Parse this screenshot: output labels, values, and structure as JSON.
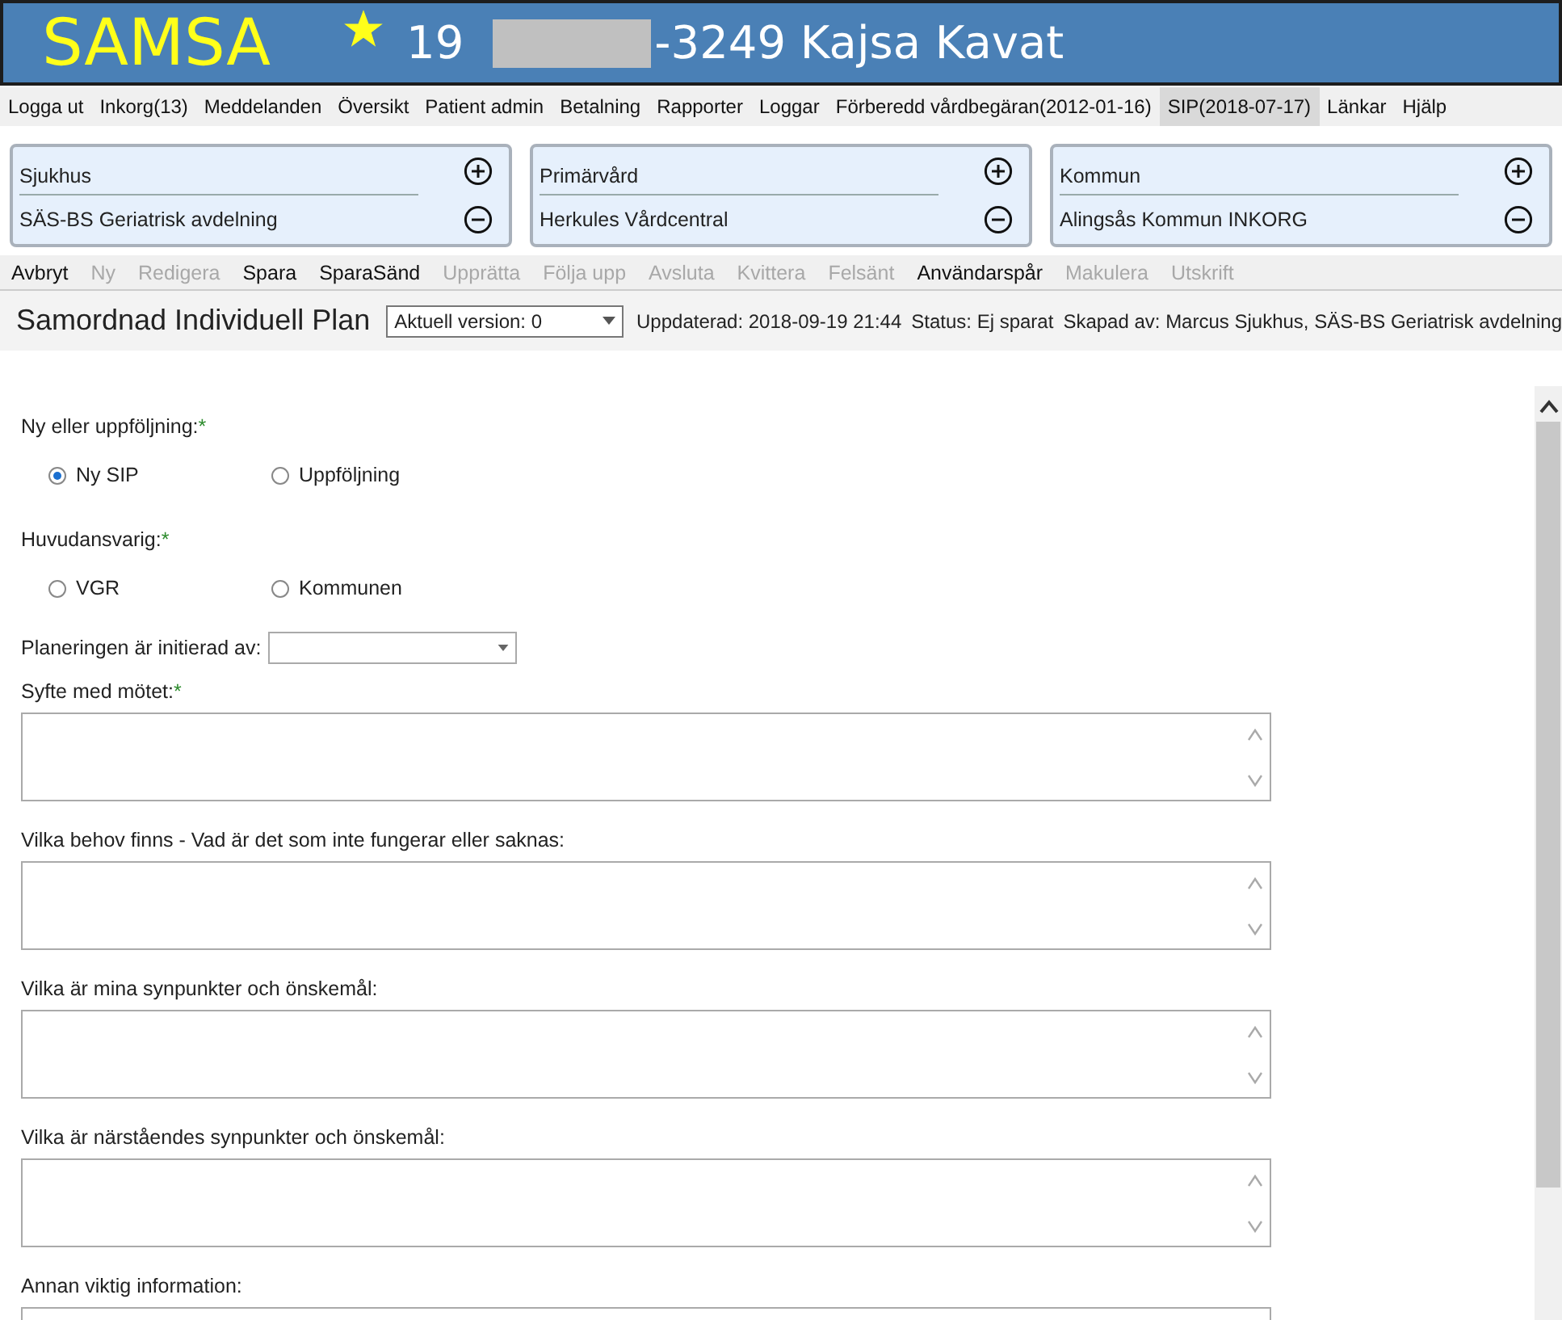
{
  "header": {
    "app_name": "SAMSA",
    "id_prefix": "19",
    "id_rest": "-3249 Kajsa Kavat"
  },
  "menu": [
    {
      "label": "Logga ut",
      "selected": false
    },
    {
      "label": "Inkorg(13)",
      "selected": false
    },
    {
      "label": "Meddelanden",
      "selected": false
    },
    {
      "label": "Översikt",
      "selected": false
    },
    {
      "label": "Patient admin",
      "selected": false
    },
    {
      "label": "Betalning",
      "selected": false
    },
    {
      "label": "Rapporter",
      "selected": false
    },
    {
      "label": "Loggar",
      "selected": false
    },
    {
      "label": "Förberedd vårdbegäran(2012-01-16)",
      "selected": false
    },
    {
      "label": "SIP(2018-07-17)",
      "selected": true
    },
    {
      "label": "Länkar",
      "selected": false
    },
    {
      "label": "Hjälp",
      "selected": false
    }
  ],
  "cards": [
    {
      "title": "Sjukhus",
      "unit": "SÄS-BS Geriatrisk avdelning"
    },
    {
      "title": "Primärvård",
      "unit": "Herkules Vårdcentral"
    },
    {
      "title": "Kommun",
      "unit": "Alingsås Kommun INKORG"
    }
  ],
  "actions": [
    {
      "label": "Avbryt",
      "disabled": false
    },
    {
      "label": "Ny",
      "disabled": true
    },
    {
      "label": "Redigera",
      "disabled": true
    },
    {
      "label": "Spara",
      "disabled": false
    },
    {
      "label": "SparaSänd",
      "disabled": false
    },
    {
      "label": "Upprätta",
      "disabled": true
    },
    {
      "label": "Följa upp",
      "disabled": true
    },
    {
      "label": "Avsluta",
      "disabled": true
    },
    {
      "label": "Kvittera",
      "disabled": true
    },
    {
      "label": "Felsänt",
      "disabled": true
    },
    {
      "label": "Användarspår",
      "disabled": false
    },
    {
      "label": "Makulera",
      "disabled": true
    },
    {
      "label": "Utskrift",
      "disabled": true
    }
  ],
  "plan": {
    "title": "Samordnad Individuell Plan",
    "version_select": "Aktuell version: 0",
    "updated": "Uppdaterad: 2018-09-19 21:44",
    "status": "Status: Ej sparat",
    "created_by": "Skapad av: Marcus Sjukhus, SÄS-BS Geriatrisk avdelning"
  },
  "form": [
    {
      "kind": "radio",
      "label": "Ny eller uppföljning:",
      "required_mark": "*",
      "options": [
        {
          "label": "Ny SIP",
          "selected": true
        },
        {
          "label": "Uppföljning",
          "selected": false
        }
      ]
    },
    {
      "kind": "radio",
      "label": "Huvudansvarig:",
      "required_mark": "*",
      "options": [
        {
          "label": "VGR",
          "selected": false
        },
        {
          "label": "Kommunen",
          "selected": false
        }
      ]
    },
    {
      "kind": "select",
      "label": "Planeringen är initierad av:"
    },
    {
      "kind": "textarea",
      "label": "Syfte med mötet:",
      "required_mark": "*"
    },
    {
      "kind": "textarea",
      "label": "Vilka behov finns - Vad är det som inte fungerar eller saknas:"
    },
    {
      "kind": "textarea",
      "label": "Vilka är mina synpunkter och önskemål:"
    },
    {
      "kind": "textarea",
      "label": "Vilka är närståendes synpunkter och önskemål:"
    },
    {
      "kind": "textarea",
      "label": "Annan viktig information:"
    }
  ]
}
